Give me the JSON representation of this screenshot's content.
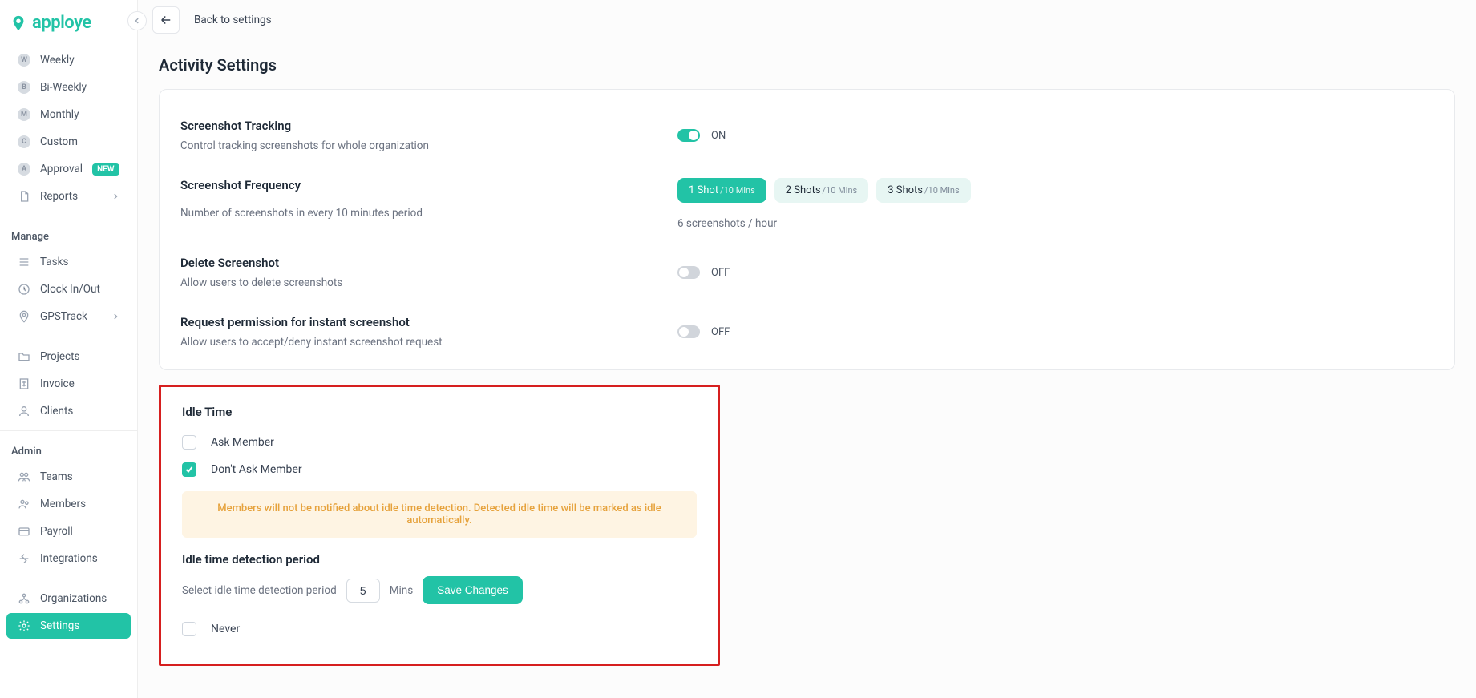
{
  "brand": {
    "name": "apploye"
  },
  "sidebar": {
    "timesheet_group": [
      "Weekly",
      "Bi-Weekly",
      "Monthly",
      "Custom",
      "Approval"
    ],
    "approval_badge": "NEW",
    "reports_label": "Reports",
    "manage_heading": "Manage",
    "manage_items": [
      "Tasks",
      "Clock In/Out",
      "GPSTrack"
    ],
    "projects_label": "Projects",
    "invoice_label": "Invoice",
    "clients_label": "Clients",
    "admin_heading": "Admin",
    "admin_items": [
      "Teams",
      "Members",
      "Payroll",
      "Integrations"
    ],
    "org_label": "Organizations",
    "settings_label": "Settings"
  },
  "topbar": {
    "back_label": "Back to settings"
  },
  "page": {
    "title": "Activity Settings"
  },
  "screenshot_tracking": {
    "title": "Screenshot Tracking",
    "sub": "Control tracking screenshots for whole organization",
    "state_label": "ON",
    "on": true
  },
  "screenshot_freq": {
    "title": "Screenshot Frequency",
    "sub": "Number of screenshots in every 10 minutes period",
    "rate": "6 screenshots / hour",
    "options": [
      {
        "main": "1 Shot",
        "suffix": "/10 Mins",
        "active": true
      },
      {
        "main": "2 Shots",
        "suffix": "/10 Mins",
        "active": false
      },
      {
        "main": "3 Shots",
        "suffix": "/10 Mins",
        "active": false
      }
    ]
  },
  "delete_shot": {
    "title": "Delete Screenshot",
    "sub": "Allow users to delete screenshots",
    "state_label": "OFF",
    "on": false
  },
  "instant_shot": {
    "title": "Request permission for instant screenshot",
    "sub": "Allow users to accept/deny instant screenshot request",
    "state_label": "OFF",
    "on": false
  },
  "idle": {
    "title": "Idle Time",
    "ask_label": "Ask Member",
    "dont_ask_label": "Don't Ask Member",
    "warning": "Members will not be notified about idle time detection. Detected idle time will be marked as idle automatically.",
    "detection_title": "Idle time detection period",
    "detection_sub": "Select idle time detection period",
    "value": "5",
    "unit": "Mins",
    "save_label": "Save Changes",
    "never_label": "Never"
  }
}
